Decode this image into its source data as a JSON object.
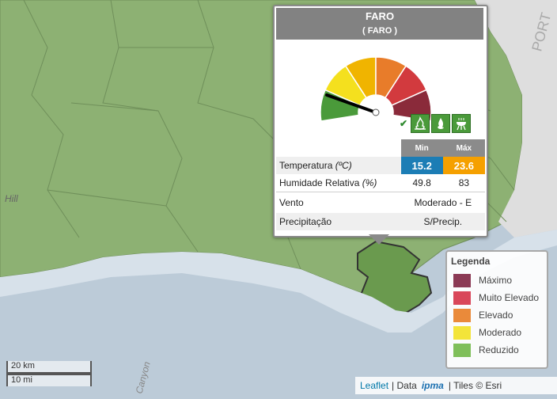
{
  "popup": {
    "title": "FARO",
    "subtitle": "( FARO )",
    "gauge_level": "Reduzido",
    "gauge_colors": [
      "#4a9a3a",
      "#f4e01e",
      "#f0b400",
      "#e87c2a",
      "#d23a3e",
      "#8a2a3a"
    ],
    "icons": [
      "check-icon",
      "fire-icon",
      "flame-icon",
      "barbecue-icon"
    ],
    "header_min": "Min",
    "header_max": "Máx",
    "temperature_label": "Temperatura",
    "temperature_unit": "(ºC)",
    "temperature_min": "15.2",
    "temperature_max": "23.6",
    "humidity_label": "Humidade Relativa",
    "humidity_unit": "(%)",
    "humidity_min": "49.8",
    "humidity_max": "83",
    "wind_label": "Vento",
    "wind_value": "Moderado - E",
    "precip_label": "Precipitação",
    "precip_value": "S/Precip."
  },
  "legend": {
    "title": "Legenda",
    "items": [
      {
        "label": "Máximo",
        "color": "#8b3a55"
      },
      {
        "label": "Muito Elevado",
        "color": "#d9475a"
      },
      {
        "label": "Elevado",
        "color": "#ea8a3a"
      },
      {
        "label": "Moderado",
        "color": "#f3e43a"
      },
      {
        "label": "Reduzido",
        "color": "#7fbf5a"
      }
    ]
  },
  "scale": {
    "km": "20 km",
    "mi": "10 mi"
  },
  "attribution": {
    "leaflet": "Leaflet",
    "data": "| Data",
    "brand": "ipma",
    "tiles": "| Tiles © Esri"
  },
  "map_labels": {
    "hill": "Hill",
    "canyon": "Canyon",
    "port": "PORT"
  }
}
